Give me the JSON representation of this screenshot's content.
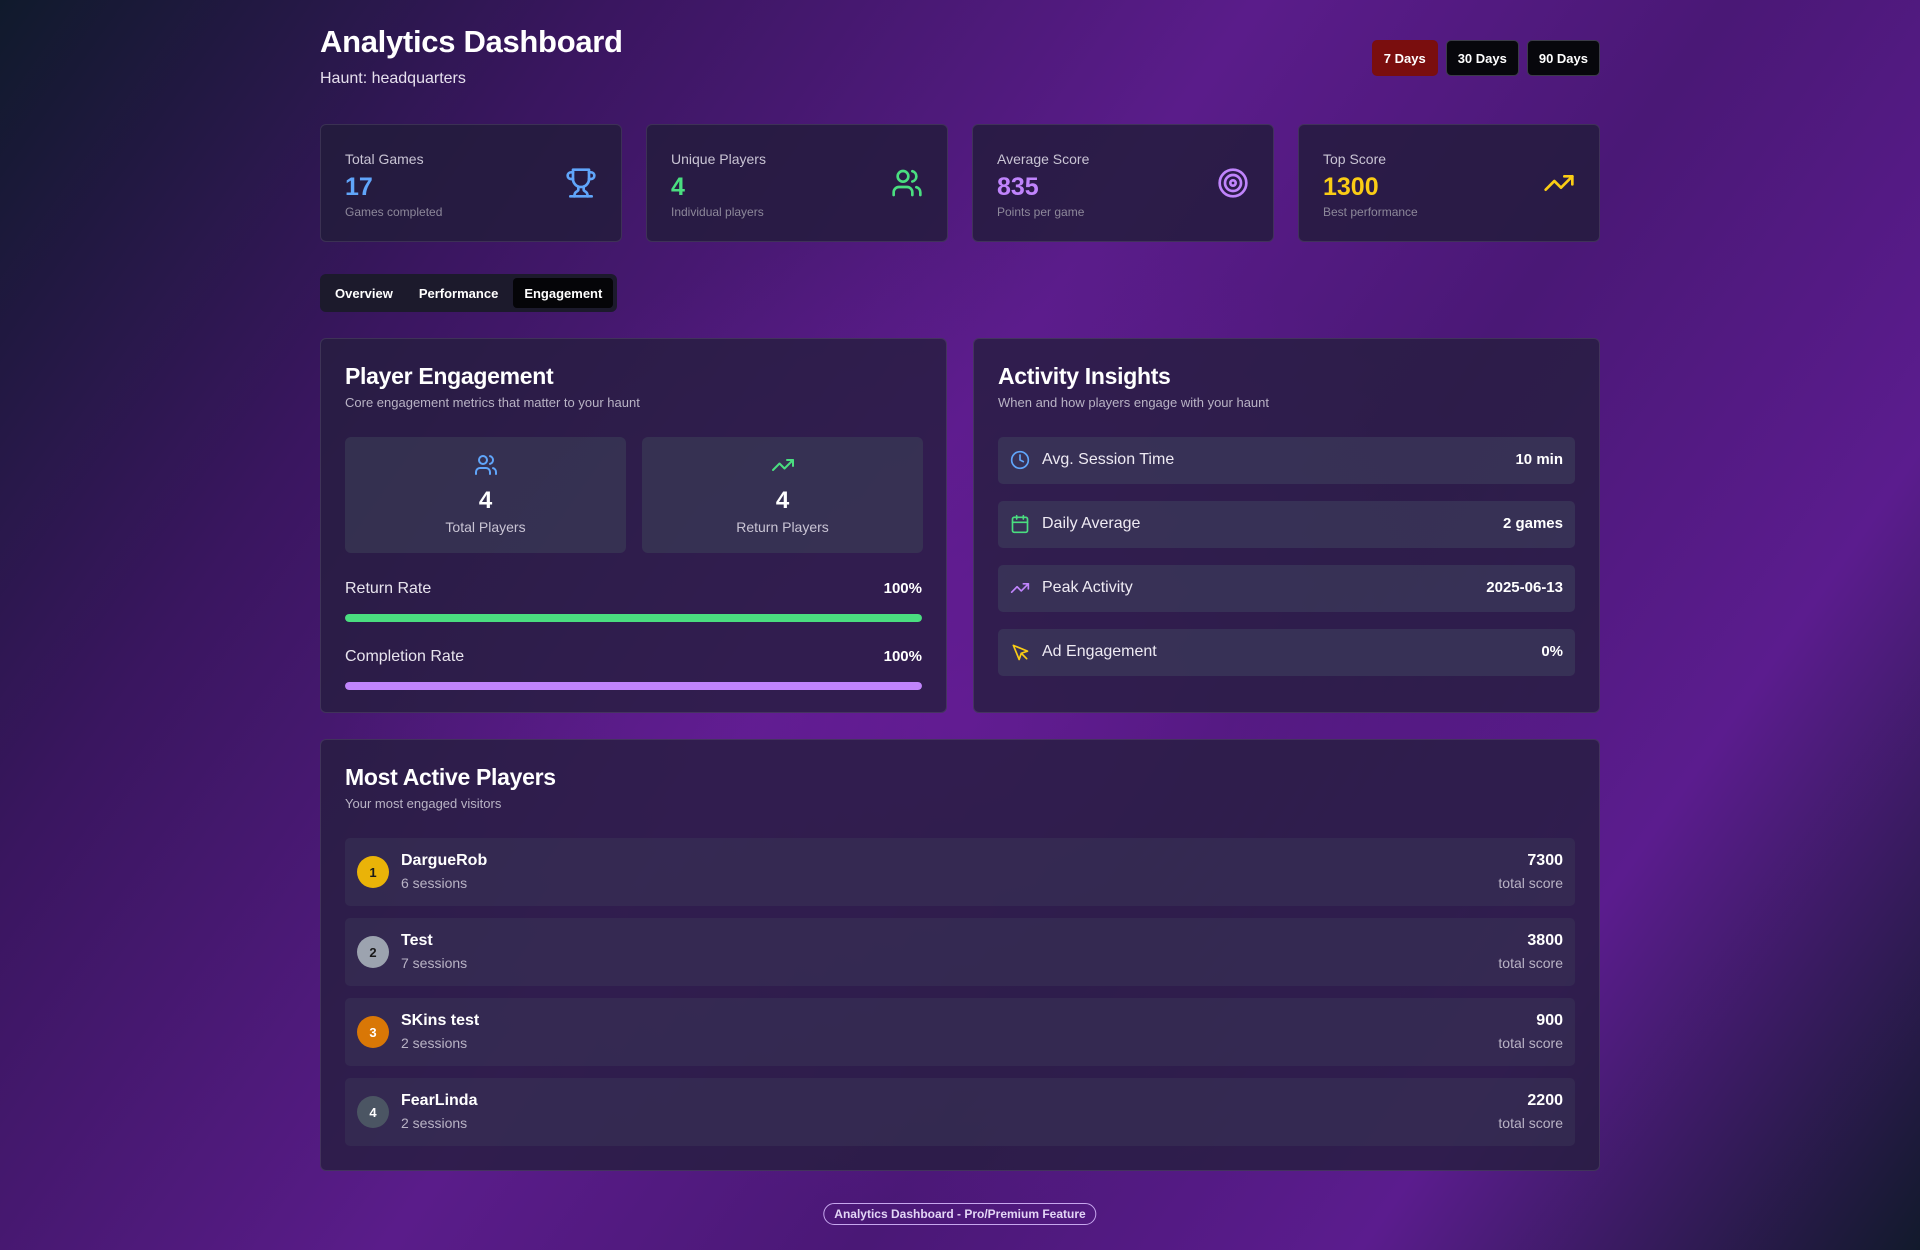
{
  "header": {
    "title": "Analytics Dashboard",
    "subtitle": "Haunt: headquarters",
    "ranges": [
      "7 Days",
      "30 Days",
      "90 Days"
    ],
    "active_range": "7 Days"
  },
  "stats": [
    {
      "label": "Total Games",
      "value": "17",
      "sub": "Games completed",
      "icon": "trophy-icon",
      "color": "#60a5fa"
    },
    {
      "label": "Unique Players",
      "value": "4",
      "sub": "Individual players",
      "icon": "users-icon",
      "color": "#4ade80"
    },
    {
      "label": "Average Score",
      "value": "835",
      "sub": "Points per game",
      "icon": "target-icon",
      "color": "#c084fc"
    },
    {
      "label": "Top Score",
      "value": "1300",
      "sub": "Best performance",
      "icon": "trending-up-icon",
      "color": "#facc15"
    }
  ],
  "tabs": [
    "Overview",
    "Performance",
    "Engagement"
  ],
  "active_tab": "Engagement",
  "engagement": {
    "title": "Player Engagement",
    "description": "Core engagement metrics that matter to your haunt",
    "cards": [
      {
        "value": "4",
        "label": "Total Players",
        "icon": "users-icon",
        "color": "#60a5fa"
      },
      {
        "value": "4",
        "label": "Return Players",
        "icon": "trending-up-icon",
        "color": "#4ade80"
      }
    ],
    "rates": [
      {
        "label": "Return Rate",
        "value": "100%",
        "fraction": 1.0,
        "color": "#4ade80"
      },
      {
        "label": "Completion Rate",
        "value": "100%",
        "fraction": 1.0,
        "color": "#c084fc"
      }
    ]
  },
  "activity": {
    "title": "Activity Insights",
    "description": "When and how players engage with your haunt",
    "items": [
      {
        "label": "Avg. Session Time",
        "value": "10 min",
        "icon": "clock-icon",
        "color": "#60a5fa"
      },
      {
        "label": "Daily Average",
        "value": "2 games",
        "icon": "calendar-icon",
        "color": "#4ade80"
      },
      {
        "label": "Peak Activity",
        "value": "2025-06-13",
        "icon": "trending-up-icon",
        "color": "#c084fc"
      },
      {
        "label": "Ad Engagement",
        "value": "0%",
        "icon": "cursor-click-icon",
        "color": "#facc15"
      }
    ]
  },
  "players": {
    "title": "Most Active Players",
    "description": "Your most engaged visitors",
    "score_label": "total score",
    "list": [
      {
        "rank": "1",
        "name": "DargueRob",
        "sessions": "6 sessions",
        "score": "7300",
        "badge_color": "#eab308",
        "badge_text": "#1a1a1a"
      },
      {
        "rank": "2",
        "name": "Test",
        "sessions": "7 sessions",
        "score": "3800",
        "badge_color": "#9ca3af",
        "badge_text": "#1a1a1a"
      },
      {
        "rank": "3",
        "name": "SKins test",
        "sessions": "2 sessions",
        "score": "900",
        "badge_color": "#d97706",
        "badge_text": "#ffffff"
      },
      {
        "rank": "4",
        "name": "FearLinda",
        "sessions": "2 sessions",
        "score": "2200",
        "badge_color": "#4b5563",
        "badge_text": "#ffffff"
      }
    ]
  },
  "footer": {
    "badge": "Analytics Dashboard - Pro/Premium Feature"
  }
}
